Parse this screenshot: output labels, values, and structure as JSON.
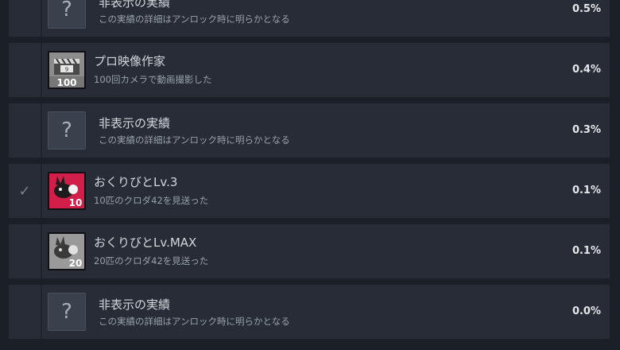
{
  "achievements": [
    {
      "title": "非表示の実績",
      "description": "この実績の詳細はアンロック時に明らかとなる",
      "percent": "0.5%",
      "hidden": true,
      "unlocked": false,
      "icon": "question-mark-icon"
    },
    {
      "title": "プロ映像作家",
      "description": "100回カメラで動画撮影した",
      "percent": "0.4%",
      "hidden": false,
      "unlocked": false,
      "icon": "clapperboard-icon",
      "badge": "100"
    },
    {
      "title": "非表示の実績",
      "description": "この実績の詳細はアンロック時に明らかとなる",
      "percent": "0.3%",
      "hidden": true,
      "unlocked": false,
      "icon": "question-mark-icon"
    },
    {
      "title": "おくりびとLv.3",
      "description": "10匹のクロダ42を見送った",
      "percent": "0.1%",
      "hidden": false,
      "unlocked": true,
      "icon": "rabbit-creature-icon",
      "badge": "10",
      "color": "#d11f4a"
    },
    {
      "title": "おくりびとLv.MAX",
      "description": "20匹のクロダ42を見送った",
      "percent": "0.1%",
      "hidden": false,
      "unlocked": false,
      "icon": "rabbit-creature-icon",
      "badge": "20",
      "color": "#9a9a9a"
    },
    {
      "title": "非表示の実績",
      "description": "この実績の詳細はアンロック時に明らかとなる",
      "percent": "0.0%",
      "hidden": true,
      "unlocked": false,
      "icon": "question-mark-icon"
    }
  ],
  "icons": {
    "question_mark": "?",
    "checkmark": "✓"
  }
}
